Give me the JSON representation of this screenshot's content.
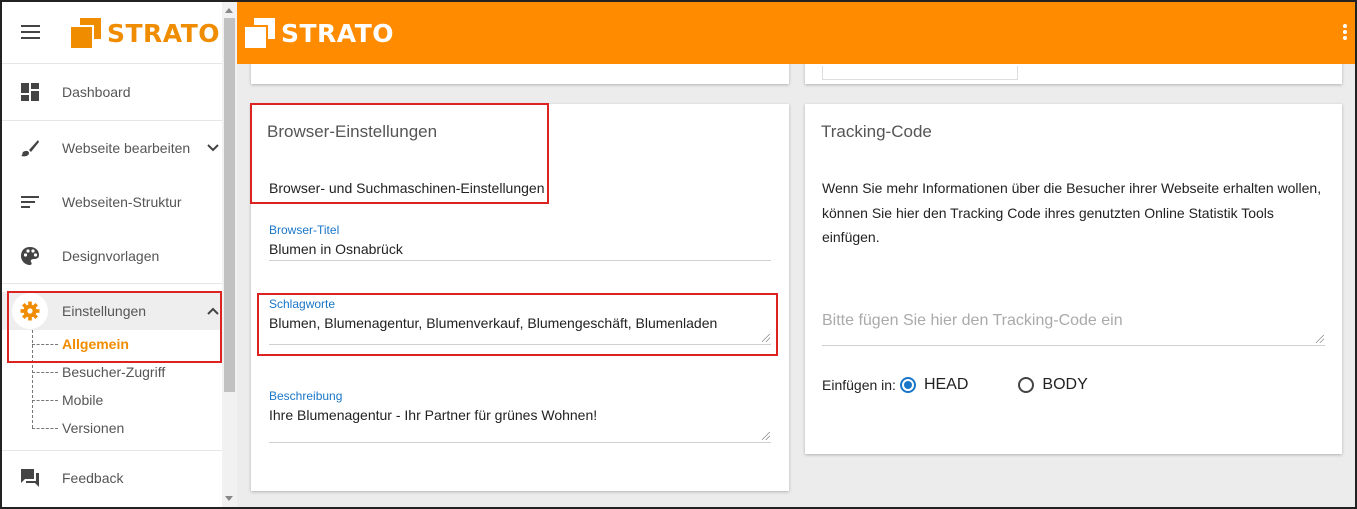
{
  "brand": {
    "name": "STRATO",
    "accent": "#ff8c00"
  },
  "sidebar": {
    "items": [
      {
        "label": "Dashboard",
        "icon": "dashboard-icon"
      },
      {
        "label": "Webseite bearbeiten",
        "icon": "brush-icon"
      },
      {
        "label": "Webseiten-Struktur",
        "icon": "structure-icon"
      },
      {
        "label": "Designvorlagen",
        "icon": "palette-icon"
      },
      {
        "label": "Einstellungen",
        "icon": "gear-icon"
      }
    ],
    "sub_items": [
      "Allgemein",
      "Besucher-Zugriff",
      "Mobile",
      "Versionen"
    ],
    "active_sub": "Allgemein",
    "feedback": {
      "label": "Feedback",
      "icon": "feedback-icon"
    }
  },
  "browser_card": {
    "title": "Browser-Einstellungen",
    "subtitle": "Browser- und Suchmaschinen-Einstellungen",
    "fields": {
      "title": {
        "label": "Browser-Titel",
        "value": "Blumen in Osnabrück"
      },
      "keywords": {
        "label": "Schlagworte",
        "value": "Blumen, Blumenagentur, Blumenverkauf, Blumengeschäft, Blumenladen"
      },
      "description": {
        "label": "Beschreibung",
        "value": "Ihre Blumenagentur - Ihr Partner für grünes Wohnen!"
      }
    }
  },
  "tracking_card": {
    "title": "Tracking-Code",
    "text": "Wenn Sie mehr Informationen über die Besucher ihrer Webseite erhalten wollen, können Sie hier den Tracking Code ihres genutzten Online Statistik Tools einfügen.",
    "placeholder": "Bitte fügen Sie hier den Tracking-Code ein",
    "insert_label": "Einfügen in:",
    "options": [
      "HEAD",
      "BODY"
    ],
    "selected": "HEAD"
  }
}
